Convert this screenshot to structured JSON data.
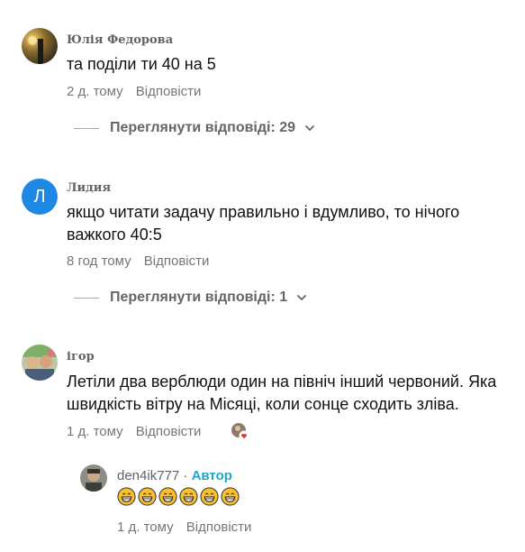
{
  "comments": [
    {
      "author": "Юлія Федорова",
      "text": "та поділи ти 40 на 5",
      "time": "2 д. тому",
      "reply_label": "Відповісти",
      "more_replies": "Переглянути відповіді: 29"
    },
    {
      "author": "Лидия",
      "avatar_letter": "Л",
      "avatar_color": "#1e88e5",
      "text_line1": "якщо читати задачу правильно і вдумливо, то нічого",
      "text_line2": "важкого 40:5",
      "time": "8 год тому",
      "reply_label": "Відповісти",
      "more_replies": "Переглянути відповіді: 1"
    },
    {
      "author": "ігор",
      "text_line1": "Летіли два верблюди один на північ інший червоний. Яка",
      "text_line2": "швидкість вітру на Місяці, коли сонце сходить зліва.",
      "time": "1 д. тому",
      "reply_label": "Відповісти"
    }
  ],
  "reply": {
    "author": "den4ik777",
    "separator": "·",
    "badge": "Автор",
    "emoji_count": 6,
    "time": "1 д. тому",
    "reply_label": "Відповісти"
  },
  "colors": {
    "author_badge": "#1ca7c4",
    "emoji_face": "#fbc02d",
    "heart": "#e53935"
  }
}
